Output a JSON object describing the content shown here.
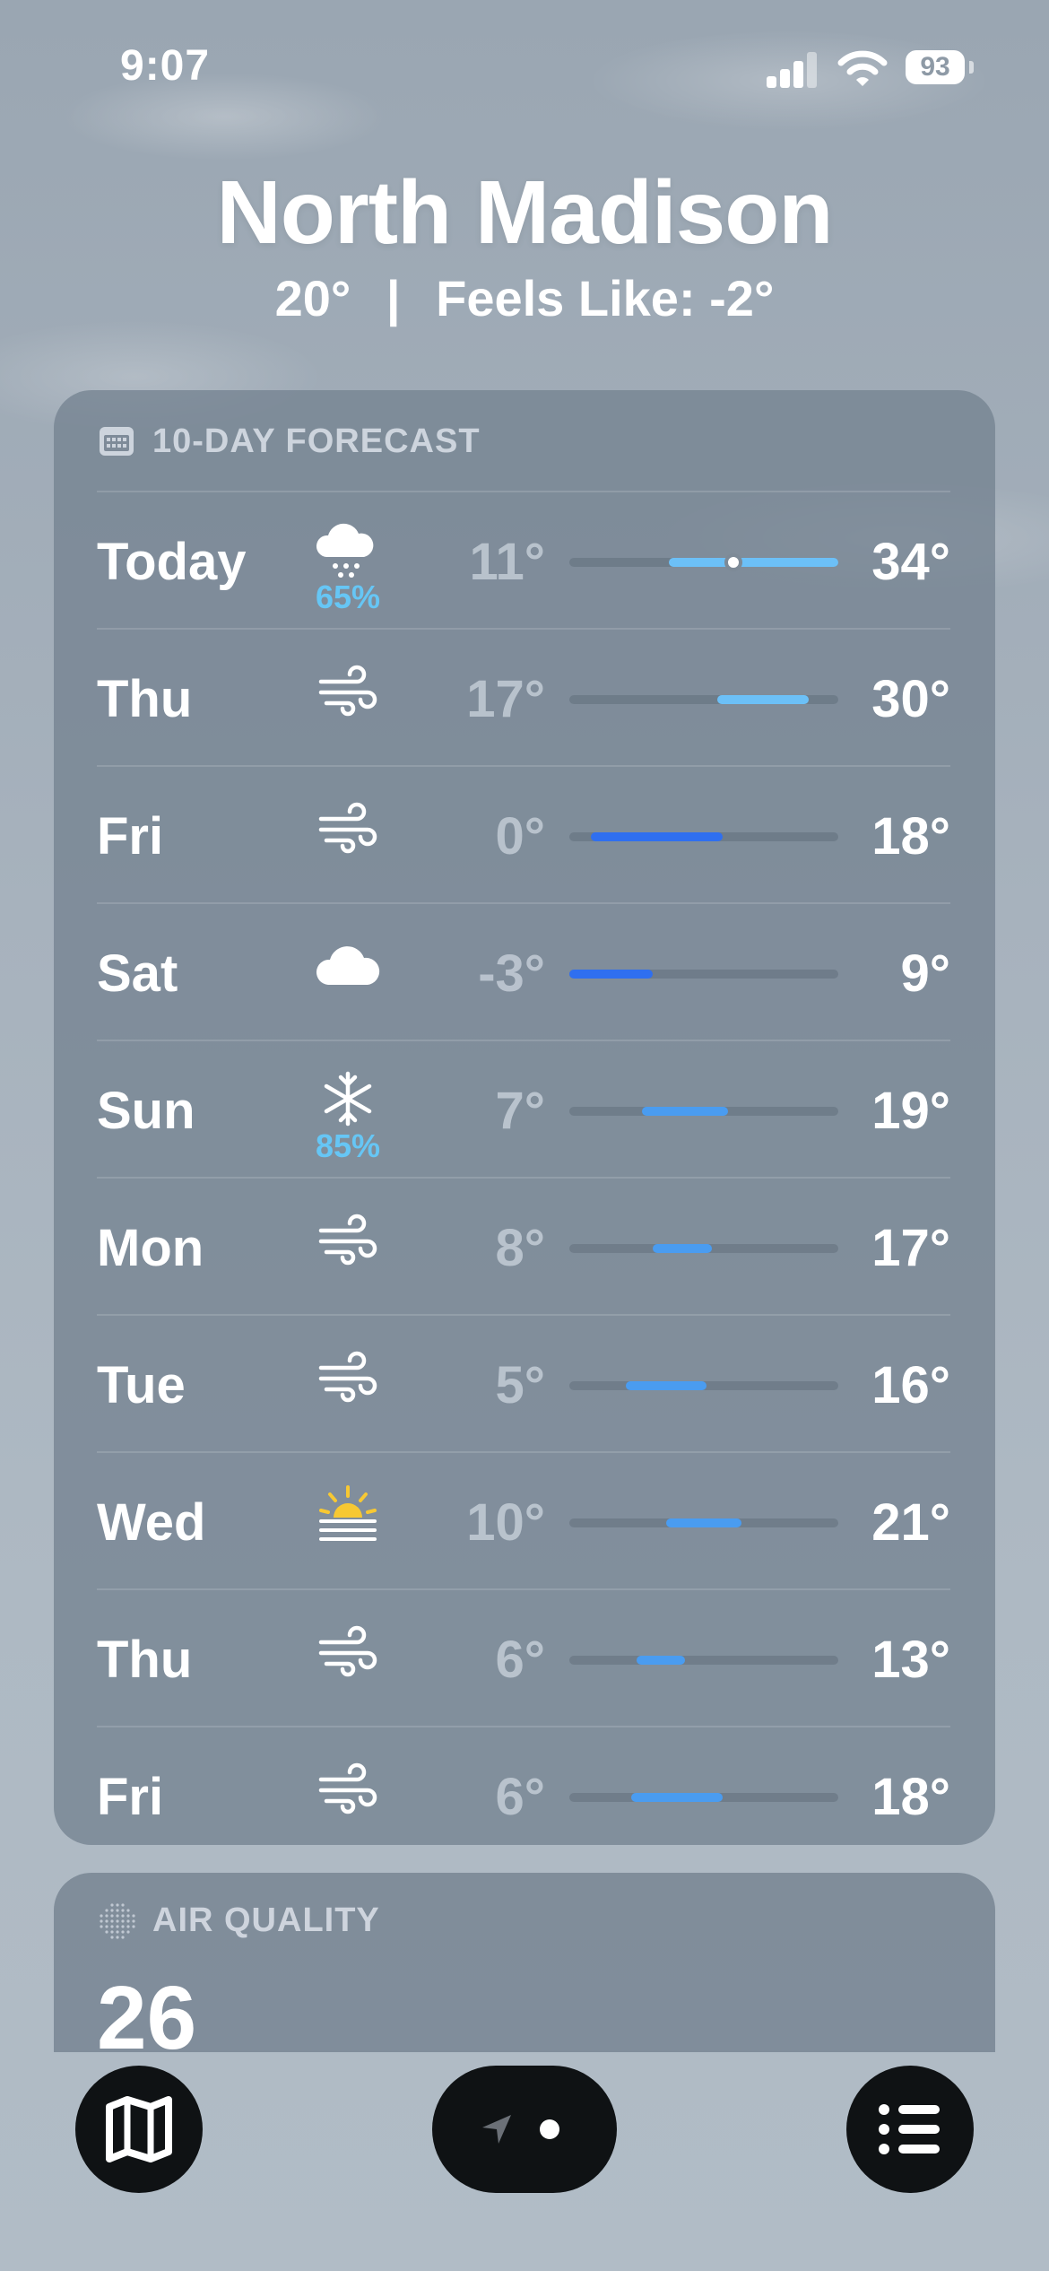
{
  "status_bar": {
    "time": "9:07",
    "battery": "93"
  },
  "location": {
    "city": "North Madison",
    "temperature": "20°",
    "separator": "|",
    "feels_like": "Feels Like: -2°"
  },
  "forecast": {
    "header": "10-DAY FORECAST",
    "days": [
      {
        "day": "Today",
        "icon": "cloud-snow-icon",
        "precip": "65%",
        "low": "11°",
        "high": "34°",
        "range_start": 0.37,
        "range_end": 1.0,
        "current": 0.61
      },
      {
        "day": "Thu",
        "icon": "wind-icon",
        "precip": "",
        "low": "17°",
        "high": "30°",
        "range_start": 0.55,
        "range_end": 0.89
      },
      {
        "day": "Fri",
        "icon": "wind-icon",
        "precip": "",
        "low": "0°",
        "high": "18°",
        "range_start": 0.08,
        "range_end": 0.57
      },
      {
        "day": "Sat",
        "icon": "cloud-icon",
        "precip": "",
        "low": "-3°",
        "high": "9°",
        "range_start": 0.0,
        "range_end": 0.31
      },
      {
        "day": "Sun",
        "icon": "snowflake-icon",
        "precip": "85%",
        "low": "7°",
        "high": "19°",
        "range_start": 0.27,
        "range_end": 0.59
      },
      {
        "day": "Mon",
        "icon": "wind-icon",
        "precip": "",
        "low": "8°",
        "high": "17°",
        "range_start": 0.31,
        "range_end": 0.53
      },
      {
        "day": "Tue",
        "icon": "wind-icon",
        "precip": "",
        "low": "5°",
        "high": "16°",
        "range_start": 0.21,
        "range_end": 0.51
      },
      {
        "day": "Wed",
        "icon": "sunrise-icon",
        "precip": "",
        "low": "10°",
        "high": "21°",
        "range_start": 0.36,
        "range_end": 0.64
      },
      {
        "day": "Thu",
        "icon": "wind-icon",
        "precip": "",
        "low": "6°",
        "high": "13°",
        "range_start": 0.25,
        "range_end": 0.43
      },
      {
        "day": "Fri",
        "icon": "wind-icon",
        "precip": "",
        "low": "6°",
        "high": "18°",
        "range_start": 0.23,
        "range_end": 0.57
      }
    ]
  },
  "air_quality": {
    "label": "AIR QUALITY",
    "value": "26"
  },
  "toolbar": {
    "map_icon": "map-icon",
    "location_icon": "location-arrow-icon",
    "list_icon": "list-icon"
  },
  "colors": {
    "precip": "#66c6f5",
    "cold": "#2f6ff0",
    "mild": "#4a9cf0",
    "warm": "#6cc0f7"
  }
}
